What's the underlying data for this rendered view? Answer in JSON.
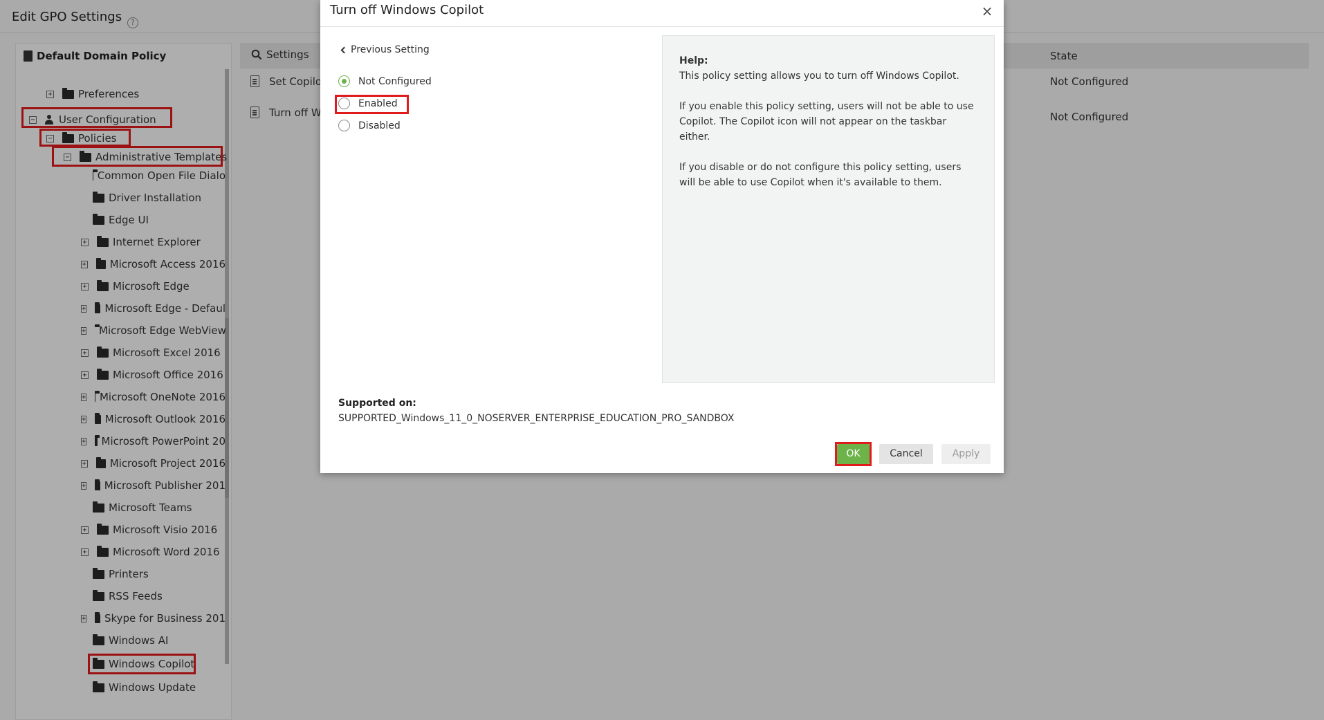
{
  "page": {
    "title": "Edit GPO Settings",
    "help_glyph": "?"
  },
  "tree": {
    "root": "Default Domain Policy",
    "expand_plus": "+",
    "expand_minus": "−",
    "items": [
      "Preferences",
      "User Configuration",
      "Policies",
      "Administrative Templates",
      "Common Open File Dialo",
      "Driver Installation",
      "Edge UI",
      "Internet Explorer",
      "Microsoft Access 2016",
      "Microsoft Edge",
      "Microsoft Edge - Defaul",
      "Microsoft Edge WebView",
      "Microsoft Excel 2016",
      "Microsoft Office 2016",
      "Microsoft OneNote 2016",
      "Microsoft Outlook 2016",
      "Microsoft PowerPoint 20",
      "Microsoft Project 2016",
      "Microsoft Publisher 201",
      "Microsoft Teams",
      "Microsoft Visio 2016",
      "Microsoft Word 2016",
      "Printers",
      "RSS Feeds",
      "Skype for Business 201",
      "Windows AI",
      "Windows Copilot",
      "Windows Update"
    ]
  },
  "settings": {
    "tab_label": "Settings",
    "state_header": "State",
    "rows": [
      {
        "name": "Set Copilo",
        "state": "Not Configured"
      },
      {
        "name": "Turn off W",
        "state": "Not Configured"
      }
    ]
  },
  "modal": {
    "title": "Turn off Windows Copilot",
    "close": "×",
    "previous": "Previous Setting",
    "options": [
      "Not Configured",
      "Enabled",
      "Disabled"
    ],
    "selected": "Not Configured",
    "help_title": "Help:",
    "help_lines": [
      "This policy setting allows you to turn off Windows Copilot.",
      "If you enable this policy setting, users will not be able to use Copilot. The Copilot icon will not appear on the taskbar either.",
      "If you disable or do not configure this policy setting, users will be able to use Copilot when it's available to them."
    ],
    "supported_label": "Supported on:",
    "supported_value": "SUPPORTED_Windows_11_0_NOSERVER_ENTERPRISE_EDUCATION_PRO_SANDBOX",
    "ok": "OK",
    "cancel": "Cancel",
    "apply": "Apply"
  },
  "colors": {
    "accent_green": "#6cb34a",
    "highlight_red": "#e01b1b"
  }
}
